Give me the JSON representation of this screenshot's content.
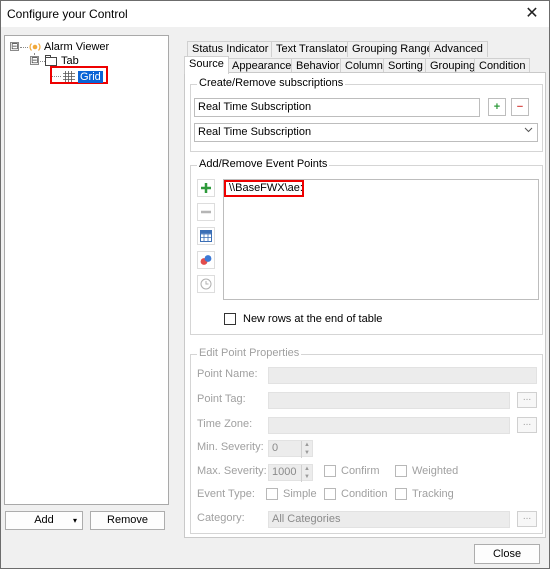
{
  "window": {
    "title": "Configure your Control",
    "close_glyph": "✕"
  },
  "tree": {
    "root": {
      "label": "Alarm Viewer",
      "expander": "⊟"
    },
    "tab": {
      "label": "Tab",
      "expander": "⊟"
    },
    "grid": {
      "label": "Grid"
    }
  },
  "left_buttons": {
    "add": "Add",
    "add_arrow": "▾",
    "remove": "Remove"
  },
  "tabs": {
    "row1": [
      "Status Indicator",
      "Text Translator",
      "Grouping Range",
      "Advanced"
    ],
    "row2": [
      "Source",
      "Appearance",
      "Behavior",
      "Column",
      "Sorting",
      "Grouping",
      "Condition"
    ],
    "active": "Source"
  },
  "subscriptions": {
    "title": "Create/Remove subscriptions",
    "name_value": "Real Time Subscription",
    "select_value": "Real Time Subscription",
    "add_glyph": "+",
    "remove_glyph": "−"
  },
  "event_points": {
    "title": "Add/Remove Event Points",
    "items": [
      "\\\\BaseFWX\\ae:"
    ],
    "new_rows_label": "New rows at the end of table"
  },
  "edit_props": {
    "title": "Edit Point Properties",
    "point_name": "Point Name:",
    "point_tag": "Point Tag:",
    "time_zone": "Time Zone:",
    "min_severity": "Min. Severity:",
    "min_value": "0",
    "max_severity": "Max. Severity:",
    "max_value": "1000",
    "confirm": "Confirm",
    "weighted": "Weighted",
    "event_type": "Event Type:",
    "simple": "Simple",
    "condition": "Condition",
    "tracking": "Tracking",
    "category": "Category:",
    "category_value": "All Categories",
    "ellipsis": "..."
  },
  "footer": {
    "close": "Close"
  }
}
